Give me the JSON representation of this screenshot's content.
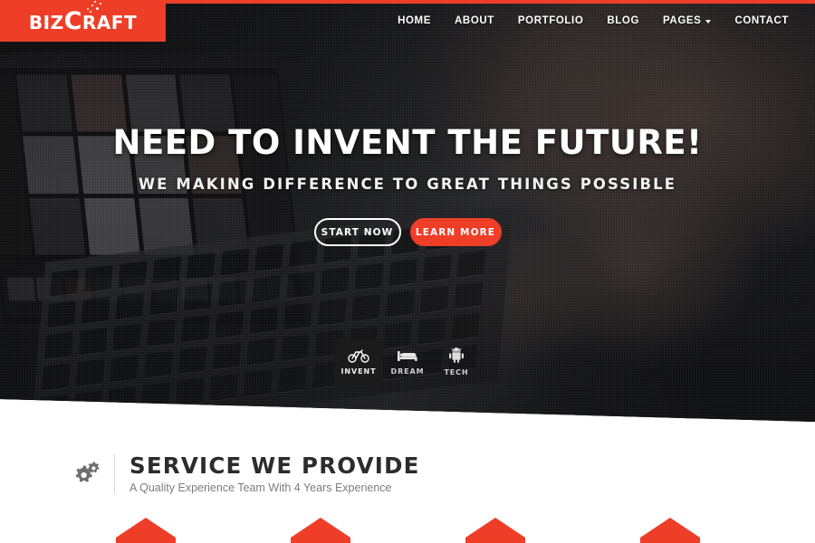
{
  "brand": {
    "name_part1": "BIZ",
    "name_part2": "C",
    "name_part3": "RAFT",
    "accent_color": "#ee3e28"
  },
  "nav": {
    "items": [
      {
        "label": "HOME",
        "has_dropdown": false
      },
      {
        "label": "ABOUT",
        "has_dropdown": false
      },
      {
        "label": "PORTFOLIO",
        "has_dropdown": false
      },
      {
        "label": "BLOG",
        "has_dropdown": false
      },
      {
        "label": "PAGES",
        "has_dropdown": true
      },
      {
        "label": "CONTACT",
        "has_dropdown": false
      }
    ]
  },
  "hero": {
    "headline": "NEED TO INVENT THE FUTURE!",
    "subheadline": "WE MAKING DIFFERENCE TO GREAT THINGS POSSIBLE",
    "primary_button": "START NOW",
    "secondary_button": "LEARN MORE",
    "tiles": [
      {
        "label": "INVENT",
        "icon": "bicycle-icon",
        "active": true
      },
      {
        "label": "DREAM",
        "icon": "bed-icon",
        "active": false
      },
      {
        "label": "TECH",
        "icon": "android-icon",
        "active": false
      }
    ]
  },
  "service_section": {
    "icon": "gears-icon",
    "title": "SERVICE WE PROVIDE",
    "subtitle": "A Quality Experience Team With 4 Years Experience",
    "cards": [
      {
        "shape": "arrow-up"
      },
      {
        "shape": "arrow-up"
      },
      {
        "shape": "arrow-up"
      },
      {
        "shape": "arrow-up"
      }
    ]
  }
}
